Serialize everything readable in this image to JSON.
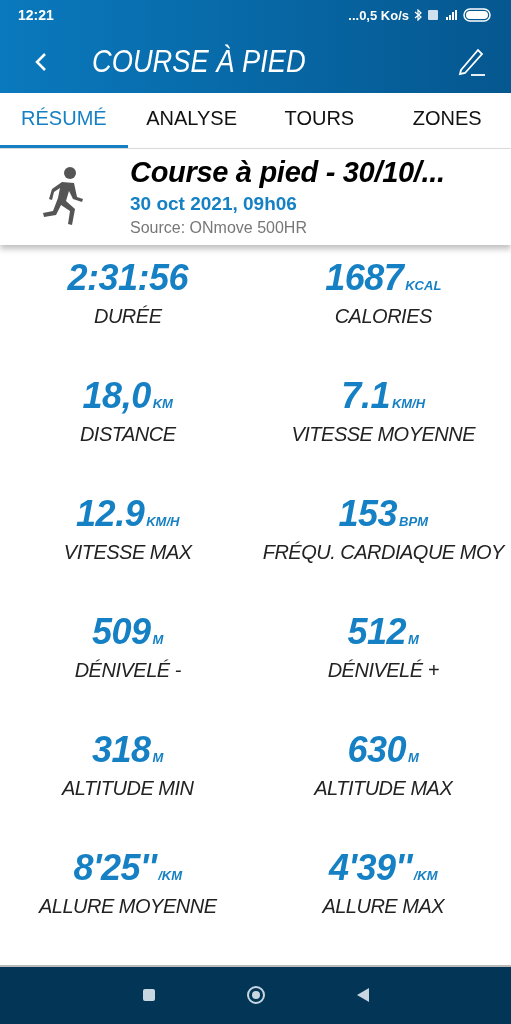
{
  "status_bar": {
    "time": "12:21",
    "network": "...0,5 Ko/s"
  },
  "app_bar": {
    "title": "COURSE À PIED"
  },
  "tabs": [
    {
      "label": "RÉSUMÉ",
      "selected": true
    },
    {
      "label": "ANALYSE",
      "selected": false
    },
    {
      "label": "TOURS",
      "selected": false
    },
    {
      "label": "ZONES",
      "selected": false
    }
  ],
  "activity": {
    "title": "Course à pied - 30/10/...",
    "date": "30 oct 2021, 09h06",
    "source": "Source: ONmove 500HR"
  },
  "stats": [
    {
      "value": "2:31:56",
      "label": "DURÉE"
    },
    {
      "value": "1687",
      "unit": "KCAL",
      "label": "CALORIES"
    },
    {
      "value": "18,0",
      "unit": "KM",
      "label": "DISTANCE"
    },
    {
      "value": "7.1",
      "unit": "KM/H",
      "label": "VITESSE MOYENNE"
    },
    {
      "value": "12.9",
      "unit": "KM/H",
      "label": "VITESSE MAX"
    },
    {
      "value": "153",
      "unit": "BPM",
      "label": "FRÉQU. CARDIAQUE MOY"
    },
    {
      "value": "509",
      "unit": "M",
      "label": "DÉNIVELÉ -"
    },
    {
      "value": "512",
      "unit": "M",
      "label": "DÉNIVELÉ +"
    },
    {
      "value": "318",
      "unit": "M",
      "label": "ALTITUDE MIN"
    },
    {
      "value": "630",
      "unit": "M",
      "label": "ALTITUDE MAX"
    },
    {
      "value": "8'25''",
      "unit": "/KM",
      "label": "ALLURE MOYENNE"
    },
    {
      "value": "4'39''",
      "unit": "/KM",
      "label": "ALLURE MAX"
    }
  ]
}
